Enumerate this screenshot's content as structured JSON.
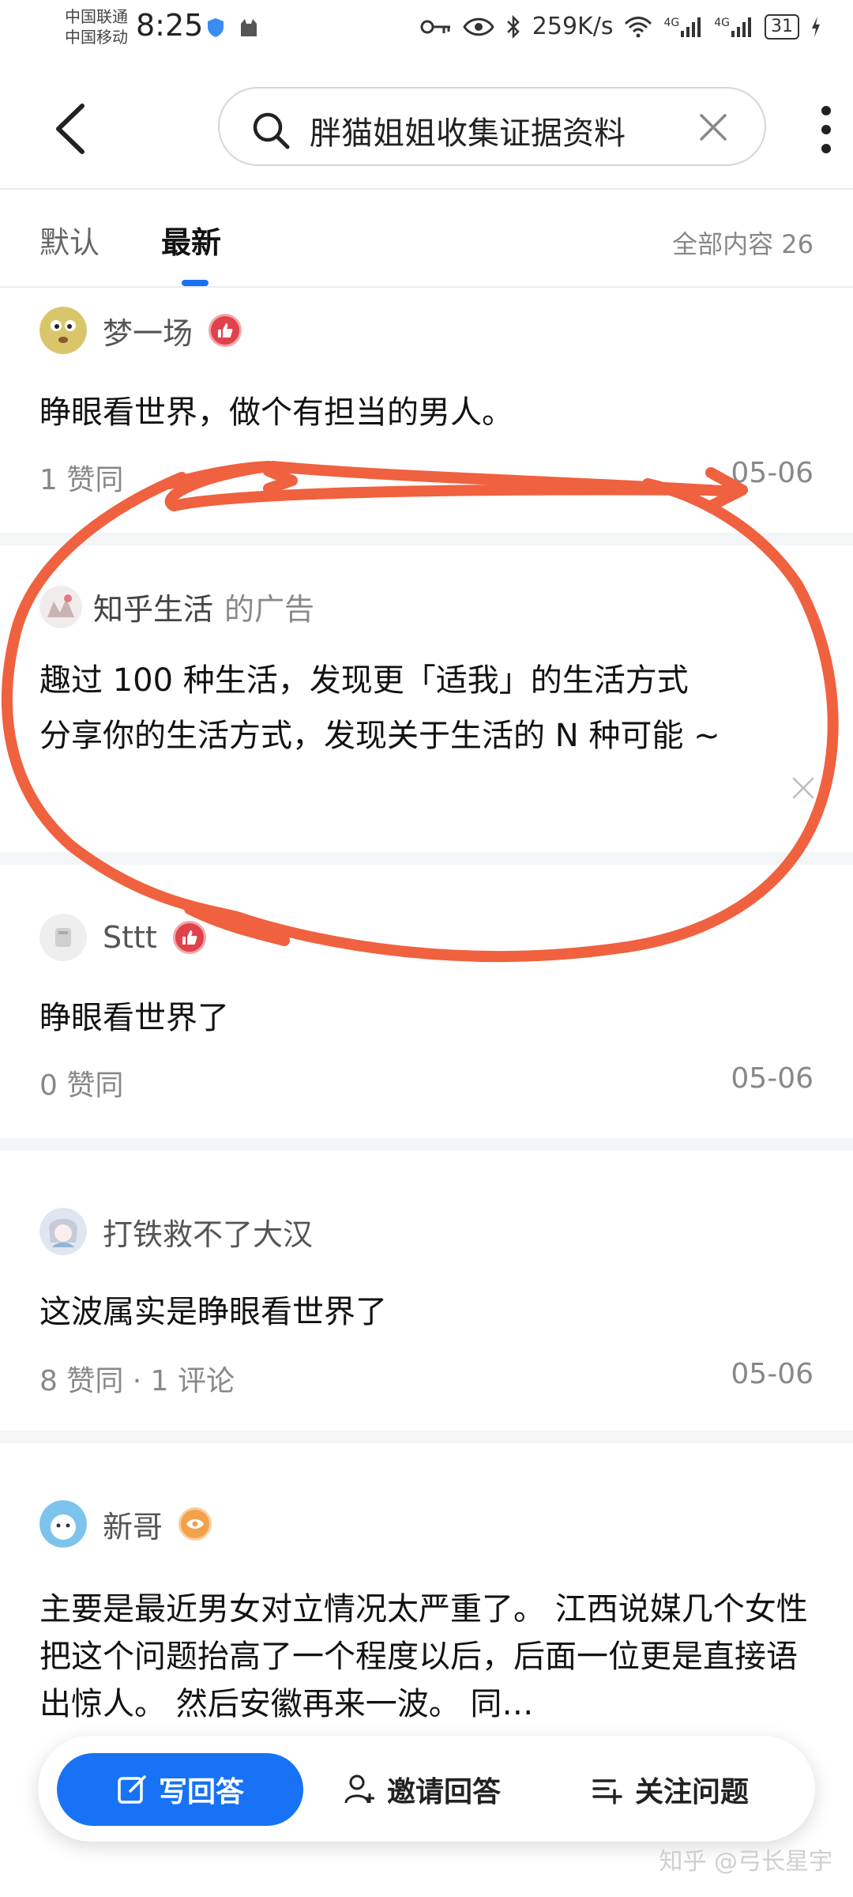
{
  "status_bar": {
    "carrier_1": "中国联通",
    "carrier_2": "中国移动",
    "time": "8:25",
    "net_speed": "259K/s",
    "signal_1": "4G",
    "signal_2": "4G",
    "battery": "31"
  },
  "header": {
    "search_text": "胖猫姐姐收集证据资料"
  },
  "tabs": {
    "default": "默认",
    "latest": "最新",
    "total": "全部内容 26"
  },
  "answers": [
    {
      "author": "梦一场",
      "content": "睁眼看世界，做个有担当的男人。",
      "meta": "1  赞同",
      "date": "05-06"
    },
    {
      "author": "Sttt",
      "content": "睁眼看世界了",
      "meta": "0 赞同",
      "date": "05-06"
    },
    {
      "author": "打铁救不了大汉",
      "content": "这波属实是睁眼看世界了",
      "meta": "8  赞同 · 1  评论",
      "date": "05-06"
    },
    {
      "author": "新哥",
      "content": "主要是最近男女对立情况太严重了。 江西说媒几个女性把这个问题抬高了一个程度以后，后面一位更是直接语出惊人。 然后安徽再来一波。 同…"
    }
  ],
  "ad": {
    "advertiser": "知乎生活",
    "suffix": "的广告",
    "line_1": "趣过 100 种生活，发现更「适我」的生活方式",
    "line_2": "分享你的生活方式，发现关于生活的 N 种可能 ~"
  },
  "bottom_bar": {
    "write_answer": "写回答",
    "invite": "邀请回答",
    "follow": "关注问题"
  },
  "watermark": "知乎 @弓长星宇",
  "colors": {
    "accent": "#1772f6",
    "annotation": "#f0613f"
  }
}
